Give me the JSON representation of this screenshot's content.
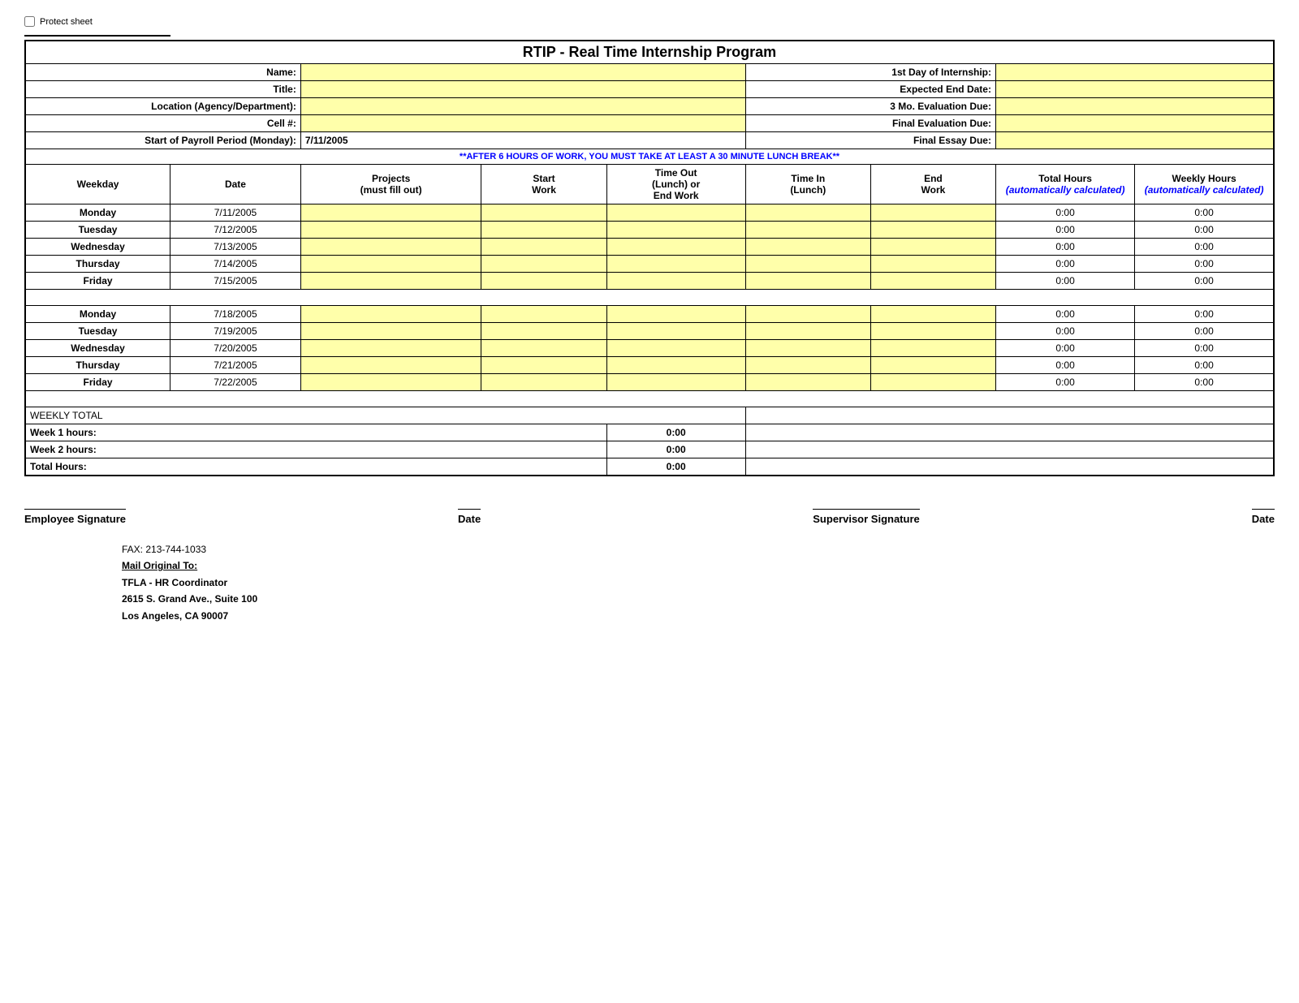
{
  "protect": {
    "checkbox_label": "Protect sheet"
  },
  "header": {
    "title": "RTIP - Real Time Internship Program"
  },
  "info_fields": {
    "name_label": "Name:",
    "title_label": "Title:",
    "location_label": "Location (Agency/Department):",
    "cell_label": "Cell #:",
    "payroll_label": "Start of Payroll Period (Monday):",
    "payroll_value": "7/11/2005",
    "first_day_label": "1st Day of Internship:",
    "expected_end_label": "Expected End Date:",
    "eval_3mo_label": "3 Mo. Evaluation Due:",
    "final_eval_label": "Final Evaluation Due:",
    "final_essay_label": "Final Essay Due:"
  },
  "notice": "**AFTER 6 HOURS OF WORK, YOU MUST TAKE AT LEAST A 30 MINUTE LUNCH BREAK**",
  "columns": {
    "weekday": "Weekday",
    "date": "Date",
    "projects": "Projects\n(must fill out)",
    "start_work": "Start\nWork",
    "timeout": "Time Out\n(Lunch) or\nEnd Work",
    "timein": "Time In\n(Lunch)",
    "end_work": "End\nWork",
    "total_hours": "Total\nHours",
    "total_hours_sub": "(automatically\ncalculated)",
    "weekly_hours": "Weekly\nHours",
    "weekly_hours_sub": "(automatically\ncalculated)"
  },
  "week1": [
    {
      "weekday": "Monday",
      "date": "7/11/2005",
      "total": "0:00",
      "weekly": "0:00"
    },
    {
      "weekday": "Tuesday",
      "date": "7/12/2005",
      "total": "0:00",
      "weekly": "0:00"
    },
    {
      "weekday": "Wednesday",
      "date": "7/13/2005",
      "total": "0:00",
      "weekly": "0:00"
    },
    {
      "weekday": "Thursday",
      "date": "7/14/2005",
      "total": "0:00",
      "weekly": "0:00"
    },
    {
      "weekday": "Friday",
      "date": "7/15/2005",
      "total": "0:00",
      "weekly": "0:00"
    }
  ],
  "week2": [
    {
      "weekday": "Monday",
      "date": "7/18/2005",
      "total": "0:00",
      "weekly": "0:00"
    },
    {
      "weekday": "Tuesday",
      "date": "7/19/2005",
      "total": "0:00",
      "weekly": "0:00"
    },
    {
      "weekday": "Wednesday",
      "date": "7/20/2005",
      "total": "0:00",
      "weekly": "0:00"
    },
    {
      "weekday": "Thursday",
      "date": "7/21/2005",
      "total": "0:00",
      "weekly": "0:00"
    },
    {
      "weekday": "Friday",
      "date": "7/22/2005",
      "total": "0:00",
      "weekly": "0:00"
    }
  ],
  "weekly_total_label": "WEEKLY TOTAL",
  "totals": {
    "week1_label": "Week 1 hours:",
    "week1_value": "0:00",
    "week2_label": "Week 2 hours:",
    "week2_value": "0:00",
    "total_label": "Total Hours:",
    "total_value": "0:00"
  },
  "signatures": {
    "employee_label": "Employee Signature",
    "date_label": "Date",
    "supervisor_label": "Supervisor Signature",
    "date2_label": "Date"
  },
  "footer": {
    "fax": "FAX:  213-744-1033",
    "mail_label": "Mail Original To:",
    "line1": "TFLA - HR Coordinator",
    "line2": "2615 S. Grand Ave., Suite 100",
    "line3": "Los Angeles, CA 90007"
  }
}
